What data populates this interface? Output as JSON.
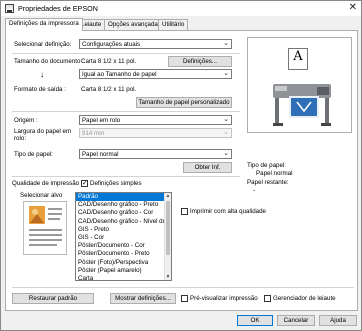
{
  "window": {
    "title": "Propriedades de EPSON"
  },
  "tabs": [
    {
      "label": "Definições da impressora"
    },
    {
      "label": "Leiaute"
    },
    {
      "label": "Opções avançadas"
    },
    {
      "label": "Utilitário"
    }
  ],
  "main": {
    "preset_label": "Selecionar definição:",
    "preset_value": "Configurações atuais",
    "doc_size_label": "Tamanho do documento :",
    "doc_size_value": "Carta 8 1/2 x 11 pol.",
    "definitions_button": "Definições...",
    "arrow_glyph": "↓",
    "paper_size_value": "Igual ao Tamanho de papel",
    "output_format_label": "Formato de saída :",
    "output_format_value": "Carta 8 1/2 x 11 pol.",
    "custom_size_button": "Tamanho de papel personalizado",
    "source_label": "Origem :",
    "source_value": "Papel em rolo",
    "roll_width_label": "Largura do papel em rolo:",
    "roll_width_value": "914 mm",
    "paper_type_label": "Tipo de papel:",
    "paper_type_value": "Papel normal",
    "get_info_button": "Obter Inf.",
    "quality_label": "Qualidade de impressão",
    "simple_settings_label": "Definições simples",
    "simple_settings_checked": true,
    "select_target_label": "Selecionar alvo",
    "targets": [
      "Padrão",
      "CAD/Desenho gráfico - Preto",
      "CAD/Desenho gráfico - Cor",
      "CAD/Desenho gráfico - Nível duplo",
      "GIS - Preto",
      "GIS - Cor",
      "Pôster/Documento - Cor",
      "Pôster/Documento - Preto",
      "Pôster (Foto)/Perspectiva",
      "Pôster (Papel amarelo)",
      "Carta"
    ],
    "selected_target_index": 0,
    "high_quality_label": "Imprimir com alta qualidade",
    "high_quality_checked": false
  },
  "preview": {
    "paper_letter": "A",
    "paper_type_title": "Tipo de papel:",
    "paper_type_value": "Papel normal",
    "remaining_title": "Papel restante:",
    "remaining_value": "-"
  },
  "bottom": {
    "restore_button": "Restaurar padrão",
    "show_settings_button": "Mostrar definições...",
    "preview_label": "Pré-visualizar impressão",
    "preview_checked": false,
    "layout_manager_label": "Gerenciador de leiaute",
    "layout_manager_checked": false
  },
  "dialog": {
    "ok_button": "OK",
    "cancel_button": "Cancelar",
    "help_button": "Ajuda"
  },
  "colors": {
    "selection": "#0078d7",
    "printer_body": "#8f9296",
    "blueprint": "#2f6fb7"
  }
}
